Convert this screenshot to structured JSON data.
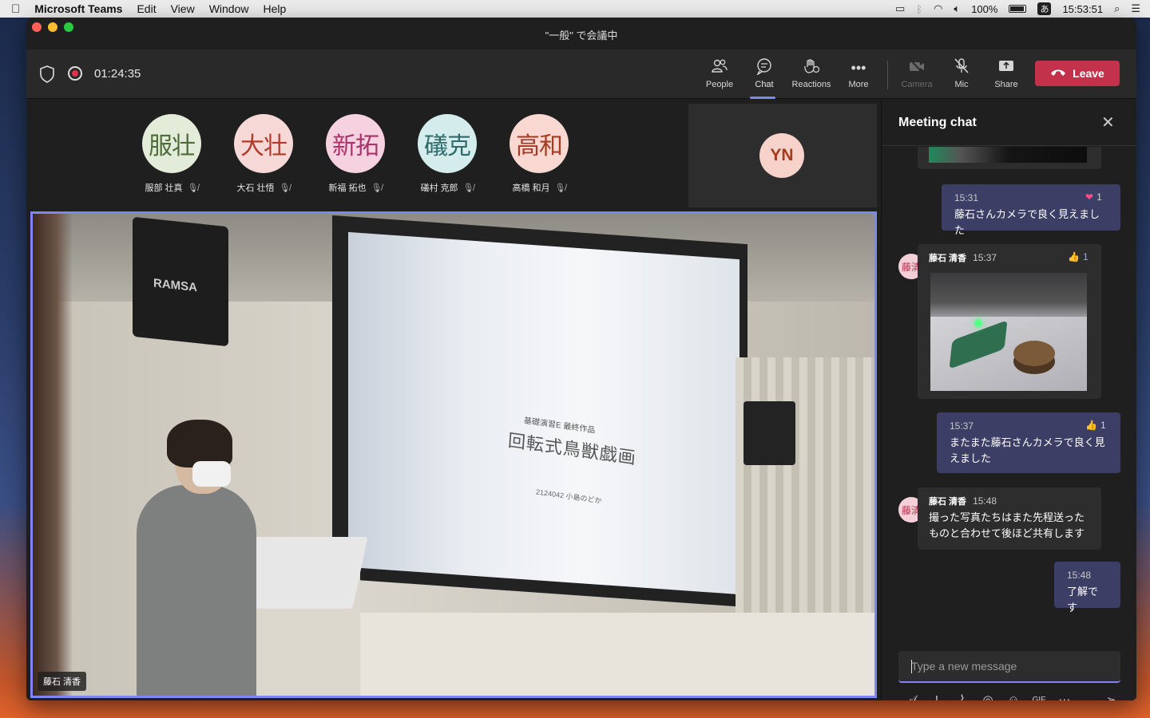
{
  "menubar": {
    "app_name": "Microsoft Teams",
    "menus": [
      "Edit",
      "View",
      "Window",
      "Help"
    ],
    "battery": "100%",
    "ime": "あ",
    "clock": "15:53:51"
  },
  "window": {
    "title": "\"一般\" で会議中"
  },
  "toolbar": {
    "timer": "01:24:35",
    "buttons": {
      "people": "People",
      "chat": "Chat",
      "reactions": "Reactions",
      "more": "More",
      "camera": "Camera",
      "mic": "Mic",
      "share": "Share"
    },
    "leave": "Leave",
    "accent": "#7f85f5",
    "leave_color": "#c4314b"
  },
  "participants": [
    {
      "initials": "服壮",
      "name": "服部 壮真",
      "bg": "#e2ecd9",
      "fg": "#4e6b3a"
    },
    {
      "initials": "大壮",
      "name": "大石 壮悟",
      "bg": "#f6d8d6",
      "fg": "#b13a2c"
    },
    {
      "initials": "新拓",
      "name": "新福 拓也",
      "bg": "#f6d2e1",
      "fg": "#a8336a"
    },
    {
      "initials": "礒克",
      "name": "礒村 克郎",
      "bg": "#d4ecec",
      "fg": "#2f6b6b"
    },
    {
      "initials": "高和",
      "name": "高橋 和月",
      "bg": "#f8d8d0",
      "fg": "#a83a22"
    }
  ],
  "self_tile": {
    "initials": "YN"
  },
  "video": {
    "speaker_label": "藤石 清香",
    "speaker_brand": "RAMSA",
    "slide": {
      "small": "基礎演習E 最終作品",
      "title": "回転式鳥獣戯画",
      "id": "2124042 小島のどか"
    }
  },
  "chat": {
    "title": "Meeting chat",
    "messages": [
      {
        "kind": "me",
        "time": "15:31",
        "text": "藤石さんカメラで良く見えました",
        "reaction": "❤",
        "count": "1"
      },
      {
        "kind": "other",
        "avatar": "藤清",
        "author": "藤石 清香",
        "time": "15:37",
        "reaction": "👍",
        "count": "1",
        "has_photo": true
      },
      {
        "kind": "me",
        "time": "15:37",
        "text": "またまた藤石さんカメラで良く見えました",
        "reaction": "👍",
        "count": "1"
      },
      {
        "kind": "other",
        "avatar": "藤清",
        "author": "藤石 清香",
        "time": "15:48",
        "text": "撮った写真たちはまた先程送ったものと合わせて後ほど共有します"
      },
      {
        "kind": "me",
        "time": "15:48",
        "text": "了解です"
      }
    ],
    "compose_placeholder": "Type a new message"
  }
}
